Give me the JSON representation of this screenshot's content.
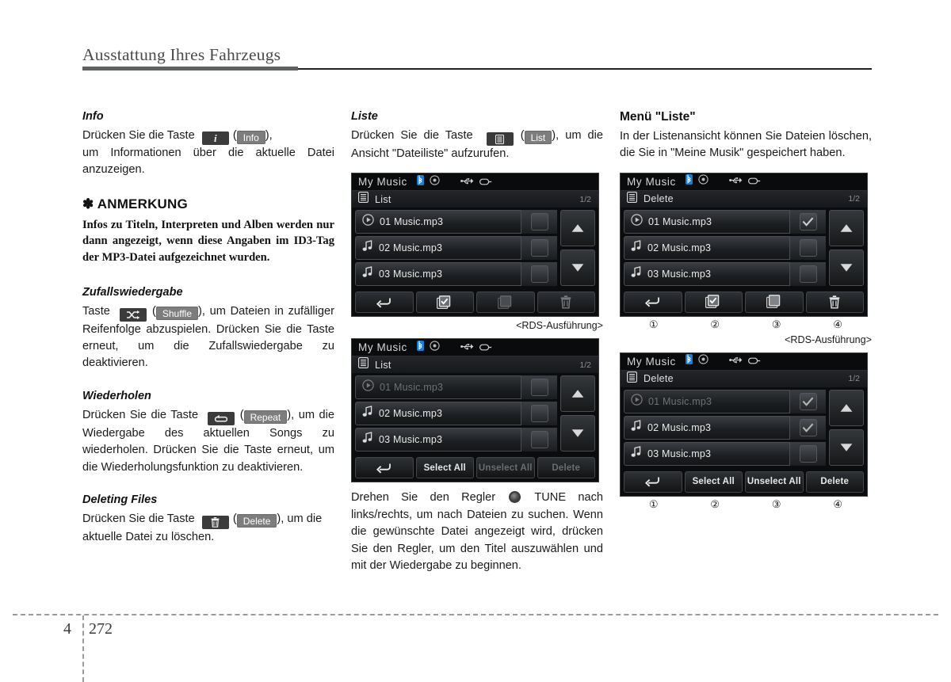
{
  "header": {
    "title": "Ausstattung Ihres Fahrzeugs"
  },
  "footer": {
    "chapter": "4",
    "page": "272"
  },
  "column1": {
    "info": {
      "heading": "Info",
      "text_before": "Drücken Sie die Taste",
      "key_icon": "info-i-icon",
      "key_label": "Info",
      "text_after": "),",
      "body": "um Informationen über die aktuelle Datei anzuzeigen."
    },
    "note": {
      "heading": "✽ ANMERKUNG",
      "text": "Infos zu Titeln, Interpreten und Alben werden nur dann angezeigt, wenn diese Angaben im ID3-Tag der MP3-Datei aufgezeichnet wurden."
    },
    "shuffle": {
      "heading": "Zufallswiedergabe",
      "text_before": "Taste",
      "key_icon": "shuffle-icon",
      "key_label": "Shuffle",
      "body": "), um Dateien in zufälliger Reifenfolge abzuspielen. Drücken Sie die Taste erneut, um die Zufallswiedergabe zu deaktivieren."
    },
    "repeat": {
      "heading": "Wiederholen",
      "text_before": "Drücken Sie die Taste",
      "key_icon": "repeat-icon",
      "key_label": "Repeat",
      "body": "), um die Wiedergabe des aktuellen Songs zu wiederholen. Drücken Sie die Taste erneut, um die Wiederholungsfunktion zu deaktivieren."
    },
    "deleting": {
      "heading": "Deleting Files",
      "text_before": "Drücken Sie die Taste",
      "key_icon": "trash-icon",
      "key_label": "Delete",
      "body": "), um die aktuelle Datei zu löschen."
    }
  },
  "column2": {
    "liste": {
      "heading": "Liste",
      "text_before": "Drücken Sie die Taste",
      "key_icon": "list-icon",
      "key_label": "List",
      "body": "), um die Ansicht \"Dateiliste\" aufzurufen."
    },
    "screen1": {
      "title": "My Music",
      "status_icons": [
        "bluetooth-icon",
        "disc-icon",
        "usb-icon",
        "aux-icon"
      ],
      "menu_icon": "list-lines-icon",
      "menu_label": "List",
      "page_indicator": "1/2",
      "rows": [
        {
          "icon": "play-circle-icon",
          "label": "01 Music.mp3",
          "checked": false,
          "dimmed": false
        },
        {
          "icon": "music-note-icon",
          "label": "02 Music.mp3",
          "checked": false,
          "dimmed": false
        },
        {
          "icon": "music-note-icon",
          "label": "03 Music.mp3",
          "checked": false,
          "dimmed": false
        }
      ],
      "scroll_up": "arrow-up-icon",
      "scroll_down": "arrow-down-icon",
      "footer_buttons": [
        {
          "icon": "back-arrow-icon",
          "label": "",
          "dim": false
        },
        {
          "icon": "select-all-icon",
          "label": "",
          "dim": false
        },
        {
          "icon": "unselect-all-icon",
          "label": "",
          "dim": true
        },
        {
          "icon": "trash-icon",
          "label": "",
          "dim": true
        }
      ],
      "caption": "<RDS-Ausführung>"
    },
    "screen2": {
      "title": "My Music",
      "status_icons": [
        "bluetooth-icon",
        "disc-icon",
        "usb-icon",
        "aux-icon"
      ],
      "menu_icon": "list-lines-icon",
      "menu_label": "List",
      "page_indicator": "1/2",
      "rows": [
        {
          "icon": "play-circle-icon",
          "label": "01 Music.mp3",
          "checked": false,
          "dimmed": true
        },
        {
          "icon": "music-note-icon",
          "label": "02 Music.mp3",
          "checked": false,
          "dimmed": false
        },
        {
          "icon": "music-note-icon",
          "label": "03 Music.mp3",
          "checked": false,
          "dimmed": false
        }
      ],
      "scroll_up": "arrow-up-icon",
      "scroll_down": "arrow-down-icon",
      "footer_buttons": [
        {
          "icon": "back-arrow-icon",
          "label": "",
          "dim": false
        },
        {
          "icon": "",
          "label": "Select All",
          "dim": false
        },
        {
          "icon": "",
          "label": "Unselect All",
          "dim": true
        },
        {
          "icon": "",
          "label": "Delete",
          "dim": true
        }
      ]
    },
    "tune_text": {
      "part1": "Drehen Sie den Regler",
      "knob_icon": "tune-knob-icon",
      "part2": "TUNE nach links/rechts, um nach Dateien zu suchen. Wenn die gewünschte Datei angezeigt wird, drücken Sie den Regler, um den Titel auszuwählen und mit der Wiedergabe zu beginnen."
    }
  },
  "column3": {
    "menu": {
      "heading": "Menü \"Liste\"",
      "body": "In der Listenansicht können Sie Dateien löschen, die Sie in \"Meine Musik\" gespeichert haben."
    },
    "screen1": {
      "title": "My Music",
      "status_icons": [
        "bluetooth-icon",
        "disc-icon",
        "usb-icon",
        "aux-icon"
      ],
      "menu_icon": "list-lines-icon",
      "menu_label": "Delete",
      "page_indicator": "1/2",
      "rows": [
        {
          "icon": "play-circle-icon",
          "label": "01 Music.mp3",
          "checked": true,
          "dimmed": false
        },
        {
          "icon": "music-note-icon",
          "label": "02 Music.mp3",
          "checked": false,
          "dimmed": false
        },
        {
          "icon": "music-note-icon",
          "label": "03 Music.mp3",
          "checked": false,
          "dimmed": false
        }
      ],
      "scroll_up": "arrow-up-icon",
      "scroll_down": "arrow-down-icon",
      "footer_buttons": [
        {
          "icon": "back-arrow-icon",
          "label": "",
          "dim": false
        },
        {
          "icon": "select-all-icon",
          "label": "",
          "dim": false
        },
        {
          "icon": "unselect-all-icon",
          "label": "",
          "dim": false
        },
        {
          "icon": "trash-icon",
          "label": "",
          "dim": false
        }
      ],
      "callouts": [
        "①",
        "②",
        "③",
        "④"
      ],
      "caption": "<RDS-Ausführung>"
    },
    "screen2": {
      "title": "My Music",
      "status_icons": [
        "bluetooth-icon",
        "disc-icon",
        "usb-icon",
        "aux-icon"
      ],
      "menu_icon": "list-lines-icon",
      "menu_label": "Delete",
      "page_indicator": "1/2",
      "rows": [
        {
          "icon": "play-circle-icon",
          "label": "01 Music.mp3",
          "checked": true,
          "dimmed": true
        },
        {
          "icon": "music-note-icon",
          "label": "02 Music.mp3",
          "checked": true,
          "dimmed": false
        },
        {
          "icon": "music-note-icon",
          "label": "03 Music.mp3",
          "checked": false,
          "dimmed": false
        }
      ],
      "scroll_up": "arrow-up-icon",
      "scroll_down": "arrow-down-icon",
      "footer_buttons": [
        {
          "icon": "back-arrow-icon",
          "label": "",
          "dim": false
        },
        {
          "icon": "",
          "label": "Select All",
          "dim": false
        },
        {
          "icon": "",
          "label": "Unselect All",
          "dim": false
        },
        {
          "icon": "",
          "label": "Delete",
          "dim": false
        }
      ],
      "callouts": [
        "①",
        "②",
        "③",
        "④"
      ]
    }
  }
}
